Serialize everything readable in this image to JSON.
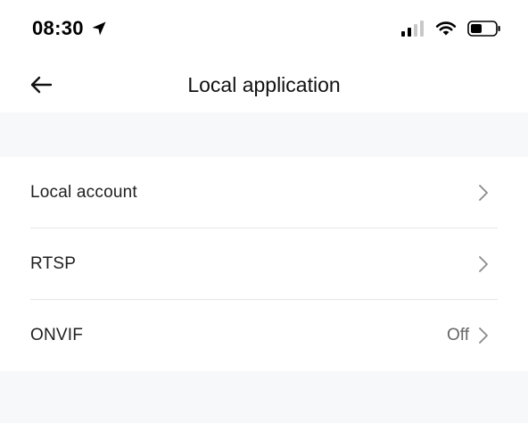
{
  "status_bar": {
    "time": "08:30",
    "location_icon": "location-arrow-icon",
    "signal_icon": "cellular-signal-icon",
    "wifi_icon": "wifi-icon",
    "battery_icon": "battery-icon"
  },
  "nav": {
    "back_icon": "back-arrow-icon",
    "title": "Local application"
  },
  "list": {
    "items": [
      {
        "label": "Local account",
        "value": "",
        "icon": "chevron-right-icon"
      },
      {
        "label": "RTSP",
        "value": "",
        "icon": "chevron-right-icon"
      },
      {
        "label": "ONVIF",
        "value": "Off",
        "icon": "chevron-right-icon"
      }
    ]
  },
  "colors": {
    "background": "#f7f8fa",
    "surface": "#ffffff",
    "divider": "#e6e6e6",
    "secondary_text": "#666666",
    "chevron": "#8a8a8a"
  }
}
